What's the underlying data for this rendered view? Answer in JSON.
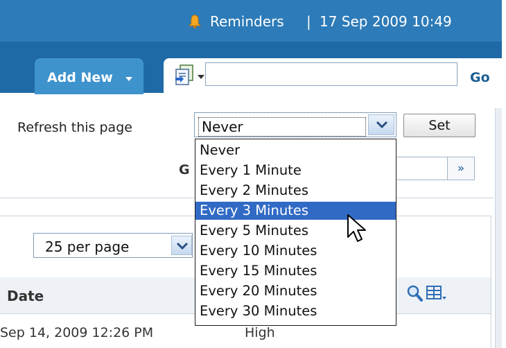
{
  "header": {
    "reminders_label": "Reminders",
    "separator": "|",
    "datetime": "17 Sep 2009 10:49"
  },
  "tabs": {
    "add_new_label": "Add New",
    "search_value": "",
    "go_label": "Go"
  },
  "refresh": {
    "label": "Refresh this page",
    "selected_value": "Never",
    "set_label": "Set",
    "options": [
      "Never",
      "Every 1 Minute",
      "Every 2 Minutes",
      "Every 3 Minutes",
      "Every 5 Minutes",
      "Every 10 Minutes",
      "Every 15 Minutes",
      "Every 20 Minutes",
      "Every 30 Minutes"
    ],
    "highlighted": "Every 3 Minutes"
  },
  "goto": {
    "label_partial": "G",
    "next_label": "»"
  },
  "grid": {
    "per_page": "25 per page",
    "column_date": "Date",
    "row1_date": "Sep 14, 2009 12:26 PM",
    "row1_priority": "High"
  },
  "colors": {
    "header_blue": "#2d7bb8",
    "tab_blue": "#3e93cd",
    "selection_blue": "#316ac5"
  },
  "icons": [
    "bell-icon",
    "document-icon",
    "search-icon",
    "grid-columns-icon",
    "chevron-down-icon",
    "pointer-cursor"
  ]
}
